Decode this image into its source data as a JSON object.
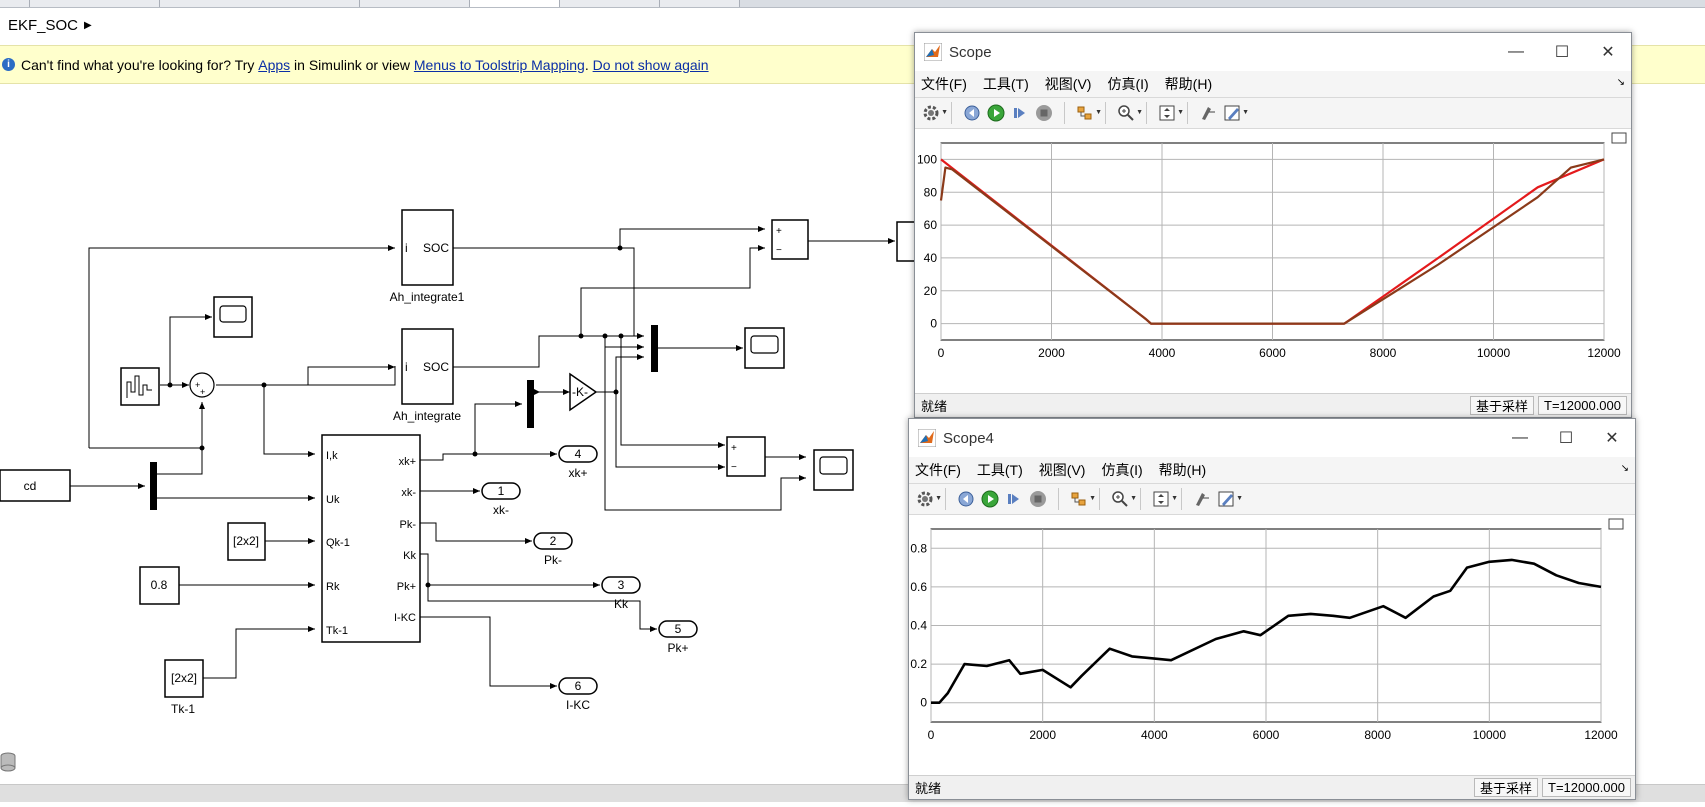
{
  "breadcrumb": {
    "model": "EKF_SOC"
  },
  "info_bar": {
    "prefix": "Can't find what you're looking for? Try ",
    "apps_link": "Apps",
    "mid": " in Simulink or view ",
    "mapping_link": "Menus to Toolstrip Mapping",
    "dot": ".",
    "dismiss_link": "Do not show again"
  },
  "diagram": {
    "ah_integrate1": {
      "in_port": "i",
      "out_port": "SOC",
      "name": "Ah_integrate1"
    },
    "ah_integrate": {
      "in_port": "i",
      "out_port": "SOC",
      "name": "Ah_integrate"
    },
    "from_cd": "cd",
    "gain": "-K-",
    "const_qk": "[2x2]",
    "const_rk": "0.8",
    "const_tk": "[2x2]",
    "const_tk_name": "Tk-1",
    "ekf_inputs": [
      "I,k",
      "Uk",
      "Qk-1",
      "Rk",
      "Tk-1"
    ],
    "ekf_outputs": [
      "xk+",
      "xk-",
      "Pk-",
      "Kk",
      "Pk+",
      "I-KC"
    ],
    "outports": [
      {
        "num": "4",
        "name": "xk+"
      },
      {
        "num": "1",
        "name": "xk-"
      },
      {
        "num": "2",
        "name": "Pk-"
      },
      {
        "num": "3",
        "name": "Kk"
      },
      {
        "num": "5",
        "name": "Pk+"
      },
      {
        "num": "6",
        "name": "I-KC"
      }
    ],
    "sum_signs": {
      "plus": "+",
      "minus": "−"
    }
  },
  "scope1": {
    "title": "Scope",
    "menus": [
      "文件(F)",
      "工具(T)",
      "视图(V)",
      "仿真(I)",
      "帮助(H)"
    ],
    "status_ready": "就绪",
    "status_mode": "基于采样",
    "status_time": "T=12000.000",
    "chart_data": {
      "type": "line",
      "xlim": [
        0,
        12000
      ],
      "ylim": [
        -10,
        110
      ],
      "xticks": [
        0,
        2000,
        4000,
        6000,
        8000,
        10000,
        12000
      ],
      "yticks": [
        0,
        20,
        40,
        60,
        80,
        100
      ],
      "grid": true,
      "series": [
        {
          "color": "#e41a1c",
          "x": [
            0,
            3700,
            3800,
            7300,
            9000,
            10800,
            12000
          ],
          "y": [
            100,
            3,
            0,
            0,
            40,
            83,
            100
          ]
        },
        {
          "color": "#8b3a1a",
          "x": [
            0,
            80,
            200,
            3700,
            3800,
            7300,
            9000,
            10800,
            11400,
            12000
          ],
          "y": [
            75,
            95,
            94,
            3,
            0,
            0,
            36,
            77,
            95,
            100
          ]
        }
      ]
    }
  },
  "scope4": {
    "title": "Scope4",
    "menus": [
      "文件(F)",
      "工具(T)",
      "视图(V)",
      "仿真(I)",
      "帮助(H)"
    ],
    "status_ready": "就绪",
    "status_mode": "基于采样",
    "status_time": "T=12000.000",
    "chart_data": {
      "type": "line",
      "xlim": [
        0,
        12000
      ],
      "ylim": [
        -0.1,
        0.9
      ],
      "xticks": [
        0,
        2000,
        4000,
        6000,
        8000,
        10000,
        12000
      ],
      "yticks": [
        0,
        0.2,
        0.4,
        0.6,
        0.8
      ],
      "grid": true,
      "series": [
        {
          "color": "#000000",
          "x": [
            0,
            150,
            300,
            600,
            1000,
            1400,
            1600,
            2000,
            2500,
            2700,
            3200,
            3600,
            4300,
            5100,
            5600,
            5900,
            6400,
            6800,
            7200,
            7500,
            8100,
            8500,
            9000,
            9300,
            9600,
            10000,
            10400,
            10800,
            11200,
            11600,
            12000
          ],
          "y": [
            0,
            0,
            0.05,
            0.2,
            0.19,
            0.22,
            0.15,
            0.17,
            0.08,
            0.14,
            0.28,
            0.24,
            0.22,
            0.33,
            0.37,
            0.35,
            0.45,
            0.46,
            0.45,
            0.44,
            0.5,
            0.44,
            0.55,
            0.58,
            0.7,
            0.73,
            0.74,
            0.72,
            0.66,
            0.62,
            0.6
          ]
        }
      ]
    }
  }
}
